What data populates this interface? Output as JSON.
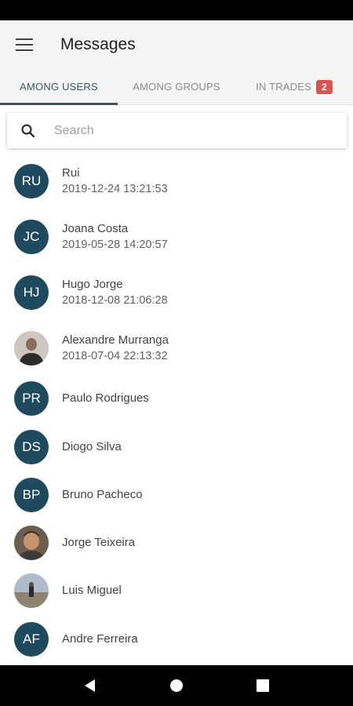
{
  "app": {
    "title": "Messages"
  },
  "tabs": [
    {
      "label": "AMONG USERS",
      "active": true
    },
    {
      "label": "AMONG GROUPS",
      "active": false
    },
    {
      "label": "IN TRADES",
      "active": false,
      "badge": "2"
    }
  ],
  "search": {
    "placeholder": "Search",
    "value": ""
  },
  "users": [
    {
      "initials": "RU",
      "name": "Rui",
      "date": "2019-12-24 13:21:53"
    },
    {
      "initials": "JC",
      "name": "Joana Costa",
      "date": "2019-05-28 14:20:57"
    },
    {
      "initials": "HJ",
      "name": "Hugo Jorge",
      "date": "2018-12-08 21:06:28"
    },
    {
      "initials": "",
      "name": "Alexandre Murranga",
      "date": "2018-07-04 22:13:32",
      "photo": true
    },
    {
      "initials": "PR",
      "name": "Paulo Rodrigues",
      "date": ""
    },
    {
      "initials": "DS",
      "name": "Diogo Silva",
      "date": ""
    },
    {
      "initials": "BP",
      "name": "Bruno Pacheco",
      "date": ""
    },
    {
      "initials": "",
      "name": "Jorge Teixeira",
      "date": "",
      "photo": true
    },
    {
      "initials": "",
      "name": "Luis Miguel",
      "date": "",
      "photo": true
    },
    {
      "initials": "AF",
      "name": "Andre Ferreira",
      "date": ""
    }
  ],
  "colors": {
    "avatar": "#1f4a5e",
    "accent": "#3a5665",
    "badge": "#d9534f"
  },
  "icons": {
    "menu": "menu-icon",
    "search": "search-icon",
    "back": "back-icon",
    "home": "home-icon",
    "recents": "recents-icon"
  }
}
